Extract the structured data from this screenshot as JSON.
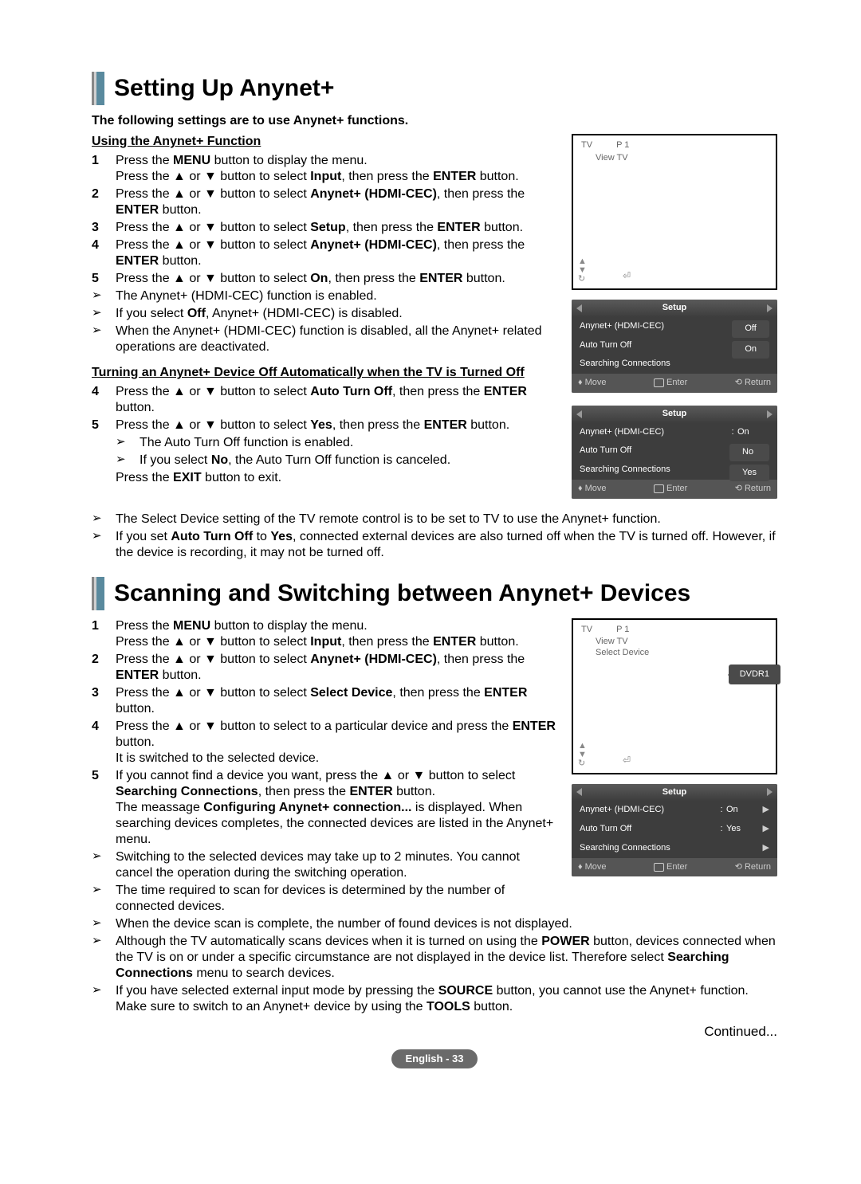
{
  "section1": {
    "heading": "Setting Up Anynet+",
    "intro": "The following settings are to use Anynet+ functions.",
    "sub1": "Using the Anynet+ Function",
    "steps1": [
      "Press the MENU button to display the menu.\nPress the ▲ or ▼ button to select Input, then press the ENTER button.",
      "Press the ▲ or ▼ button to select Anynet+ (HDMI-CEC), then press the ENTER button.",
      "Press the ▲ or ▼ button to select Setup, then press the ENTER button.",
      "Press the ▲ or ▼ button to select Anynet+ (HDMI-CEC), then press the ENTER button.",
      "Press the ▲ or ▼ button to select On, then press the ENTER button."
    ],
    "notes1": [
      "The Anynet+ (HDMI-CEC) function is enabled.",
      "If you select Off, Anynet+ (HDMI-CEC) is disabled.",
      "When the Anynet+ (HDMI-CEC) function is disabled, all the Anynet+ related operations are deactivated."
    ],
    "sub2": "Turning an Anynet+ Device Off Automatically when the TV is Turned Off",
    "steps2": [
      {
        "num": "4",
        "text": "Press the ▲ or ▼ button to select Auto Turn Off, then press the ENTER button."
      },
      {
        "num": "5",
        "text": "Press the ▲ or ▼ button to select Yes, then press the ENTER button."
      }
    ],
    "subnotes2": [
      "The Auto Turn Off function is enabled.",
      "If you select No, the Auto Turn Off function is canceled."
    ],
    "exit_line": "Press the EXIT button to exit.",
    "notes2": [
      "The Select Device setting of the TV remote control is to be set to TV to use the Anynet+ function.",
      "If you set Auto Turn Off to Yes, connected external devices are also turned off when the TV is turned off. However, if the device is recording, it may not be turned off."
    ]
  },
  "section2": {
    "heading": "Scanning and Switching between Anynet+ Devices",
    "steps": [
      "Press the MENU button to display the menu.\nPress the ▲ or ▼ button to select Input, then press the ENTER button.",
      "Press the ▲ or ▼ button to select Anynet+ (HDMI-CEC), then press the ENTER button.",
      "Press the ▲ or ▼ button to select Select Device, then press the ENTER button.",
      "Press the ▲ or ▼ button to select to a particular device and press the ENTER button.\nIt is switched to the selected device.",
      "If you cannot find a device you want, press the ▲ or ▼ button to select Searching Connections, then press the ENTER button.\nThe meassage Configuring Anynet+ connection... is displayed. When searching devices completes, the connected devices are listed in the Anynet+ menu."
    ],
    "notes": [
      "Switching to the selected devices may take up to 2 minutes. You cannot cancel the operation during the switching operation.",
      "The time required to scan for devices is determined by the number of connected devices.",
      "When the device scan is complete, the number of found devices is not displayed.",
      "Although the TV automatically scans devices when it is turned on using the POWER button, devices connected when the TV is on or under a specific circumstance are not displayed in the device list. Therefore select Searching Connections menu to search devices.",
      "If you have selected external input mode by pressing the SOURCE button, you cannot use the Anynet+ function. Make sure to switch to an Anynet+ device by using the TOOLS button."
    ]
  },
  "tv1": {
    "header_tv": "TV",
    "header_p": "P 1",
    "view": "View TV"
  },
  "osd1": {
    "title": "Setup",
    "r1": "Anynet+ (HDMI-CEC)",
    "pill1": "Off",
    "pill2": "On",
    "r2": "Auto Turn Off",
    "r3": "Searching Connections",
    "f_move": "Move",
    "f_enter": "Enter",
    "f_return": "Return"
  },
  "osd2": {
    "title": "Setup",
    "r1": "Anynet+ (HDMI-CEC)",
    "r1v": "On",
    "r2": "Auto Turn Off",
    "pill1": "No",
    "pill2": "Yes",
    "r3": "Searching Connections",
    "f_move": "Move",
    "f_enter": "Enter",
    "f_return": "Return"
  },
  "tv2": {
    "header_tv": "TV",
    "header_p": "P 1",
    "view": "View TV",
    "select": "Select Device",
    "tooltip": "DVDR1"
  },
  "osd3": {
    "title": "Setup",
    "r1": "Anynet+ (HDMI-CEC)",
    "r1v": "On",
    "r2": "Auto Turn Off",
    "r2v": "Yes",
    "r3": "Searching Connections",
    "f_move": "Move",
    "f_enter": "Enter",
    "f_return": "Return"
  },
  "continued": "Continued...",
  "page": "English - 33"
}
